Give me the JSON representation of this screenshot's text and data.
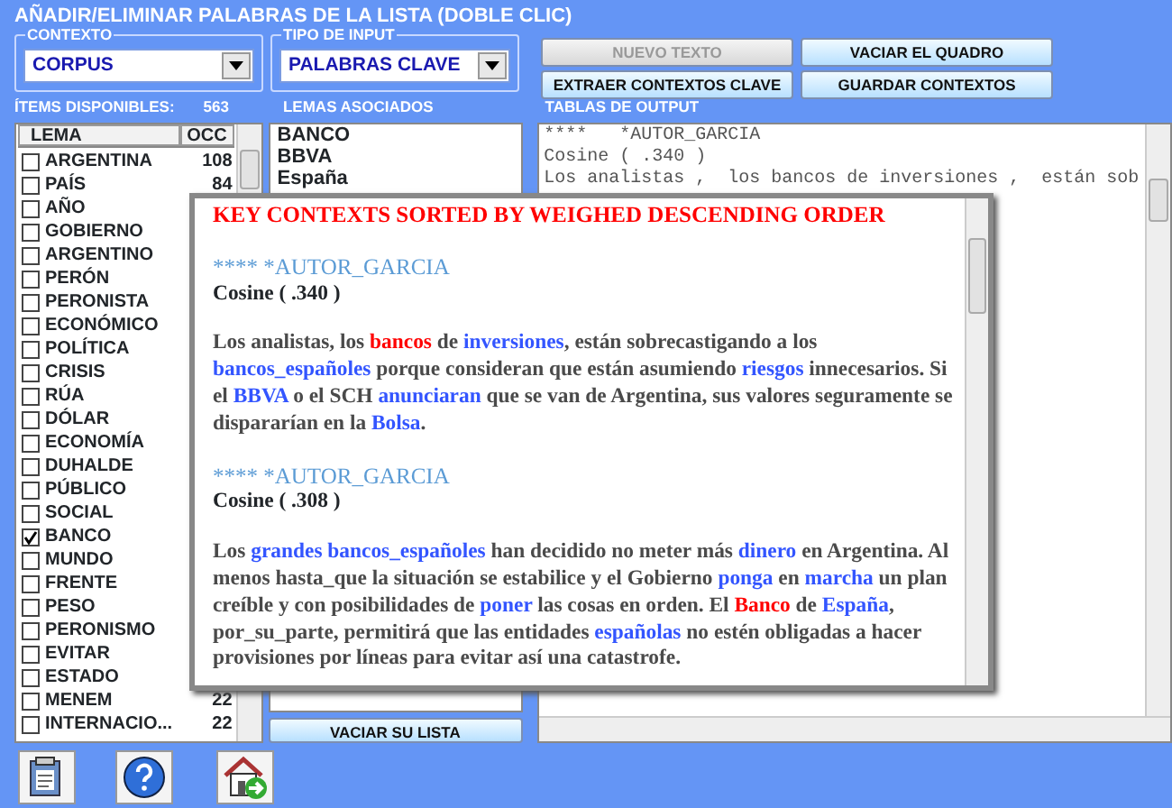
{
  "window": {
    "title": "AÑADIR/ELIMINAR PALABRAS DE LA LISTA (DOBLE CLIC)"
  },
  "contexto": {
    "label": "CONTEXTO",
    "value": "CORPUS"
  },
  "tipo_input": {
    "label": "TIPO DE INPUT",
    "value": "PALABRAS CLAVE"
  },
  "buttons": [
    {
      "label": "NUEVO TEXTO",
      "disabled": true
    },
    {
      "label": "VACIAR EL QUADRO",
      "disabled": false
    },
    {
      "label": "EXTRAER CONTEXTOS CLAVE",
      "disabled": false
    },
    {
      "label": "GUARDAR CONTEXTOS",
      "disabled": false
    }
  ],
  "items_label": "ÍTEMS DISPONIBLES:",
  "items_count": "563",
  "lemas_label": "LEMAS ASOCIADOS",
  "output_label": "TABLAS DE OUTPUT",
  "items_table": {
    "columns": [
      "LEMA",
      "OCC"
    ],
    "rows": [
      {
        "lema": "ARGENTINA",
        "occ": "108",
        "checked": false
      },
      {
        "lema": "PAÍS",
        "occ": "84",
        "checked": false
      },
      {
        "lema": "AÑO",
        "checked": false
      },
      {
        "lema": "GOBIERNO",
        "checked": false
      },
      {
        "lema": "ARGENTINO",
        "checked": false
      },
      {
        "lema": "PERÓN",
        "checked": false
      },
      {
        "lema": "PERONISTA",
        "checked": false
      },
      {
        "lema": "ECONÓMICO",
        "checked": false
      },
      {
        "lema": "POLÍTICA",
        "checked": false
      },
      {
        "lema": "CRISIS",
        "checked": false
      },
      {
        "lema": "RÚA",
        "checked": false
      },
      {
        "lema": "DÓLAR",
        "checked": false
      },
      {
        "lema": "ECONOMÍA",
        "checked": false
      },
      {
        "lema": "DUHALDE",
        "checked": false
      },
      {
        "lema": "PÚBLICO",
        "checked": false
      },
      {
        "lema": "SOCIAL",
        "checked": false
      },
      {
        "lema": "BANCO",
        "checked": true
      },
      {
        "lema": "MUNDO",
        "checked": false
      },
      {
        "lema": "FRENTE",
        "checked": false
      },
      {
        "lema": "PESO",
        "checked": false
      },
      {
        "lema": "PERONISMO",
        "checked": false
      },
      {
        "lema": "EVITAR",
        "checked": false
      },
      {
        "lema": "ESTADO",
        "checked": false
      },
      {
        "lema": "MENEM",
        "occ": "22",
        "checked": false
      },
      {
        "lema": "INTERNACIO...",
        "occ": "22",
        "checked": false
      }
    ]
  },
  "lemas": [
    "BANCO",
    "BBVA",
    "España"
  ],
  "lemas_button": "VACIAR SU LISTA",
  "output_lines": [
    "****   *AUTOR_GARCIA",
    "Cosine ( .340 )",
    "Los analistas ,  los bancos de inversiones ,  están sob"
  ],
  "popup": {
    "title": "KEY CONTEXTS SORTED BY WEIGHED DESCENDING ORDER",
    "entries": [
      {
        "author": "**** *AUTOR_GARCIA",
        "cosine": "Cosine ( .340 )",
        "paragraph": [
          {
            "text": "Los analistas, los ",
            "kind": "plain"
          },
          {
            "text": "bancos",
            "kind": "key"
          },
          {
            "text": " de ",
            "kind": "plain"
          },
          {
            "text": "inversiones",
            "kind": "related"
          },
          {
            "text": ", están sobrecastigando a los ",
            "kind": "plain"
          },
          {
            "text": "bancos_españoles",
            "kind": "related"
          },
          {
            "text": " porque consideran que están asumiendo ",
            "kind": "plain"
          },
          {
            "text": "riesgos",
            "kind": "related"
          },
          {
            "text": " innecesarios. Si el ",
            "kind": "plain"
          },
          {
            "text": "BBVA",
            "kind": "related"
          },
          {
            "text": " o el SCH ",
            "kind": "plain"
          },
          {
            "text": "anunciaran",
            "kind": "related"
          },
          {
            "text": " que se van de Argentina, sus valores seguramente se dispararían en la ",
            "kind": "plain"
          },
          {
            "text": "Bolsa",
            "kind": "related"
          },
          {
            "text": ".",
            "kind": "plain"
          }
        ]
      },
      {
        "author": "**** *AUTOR_GARCIA",
        "cosine": "Cosine ( .308 )",
        "paragraph": [
          {
            "text": "Los ",
            "kind": "plain"
          },
          {
            "text": "grandes bancos_españoles",
            "kind": "related"
          },
          {
            "text": " han decidido no meter más ",
            "kind": "plain"
          },
          {
            "text": "dinero",
            "kind": "related"
          },
          {
            "text": " en Argentina. Al menos hasta_que la situación se estabilice y el Gobierno ",
            "kind": "plain"
          },
          {
            "text": "ponga",
            "kind": "related"
          },
          {
            "text": " en ",
            "kind": "plain"
          },
          {
            "text": "marcha",
            "kind": "related"
          },
          {
            "text": " un plan creíble y con posibilidades de ",
            "kind": "plain"
          },
          {
            "text": "poner",
            "kind": "related"
          },
          {
            "text": " las cosas en orden. El ",
            "kind": "plain"
          },
          {
            "text": "Banco",
            "kind": "key"
          },
          {
            "text": " de ",
            "kind": "plain"
          },
          {
            "text": "España",
            "kind": "related"
          },
          {
            "text": ", por_su_parte, permitirá que las entidades ",
            "kind": "plain"
          },
          {
            "text": "españolas",
            "kind": "related"
          },
          {
            "text": " no estén obligadas a hacer provisiones por líneas para evitar así una catastrofe.",
            "kind": "plain"
          }
        ]
      }
    ]
  }
}
